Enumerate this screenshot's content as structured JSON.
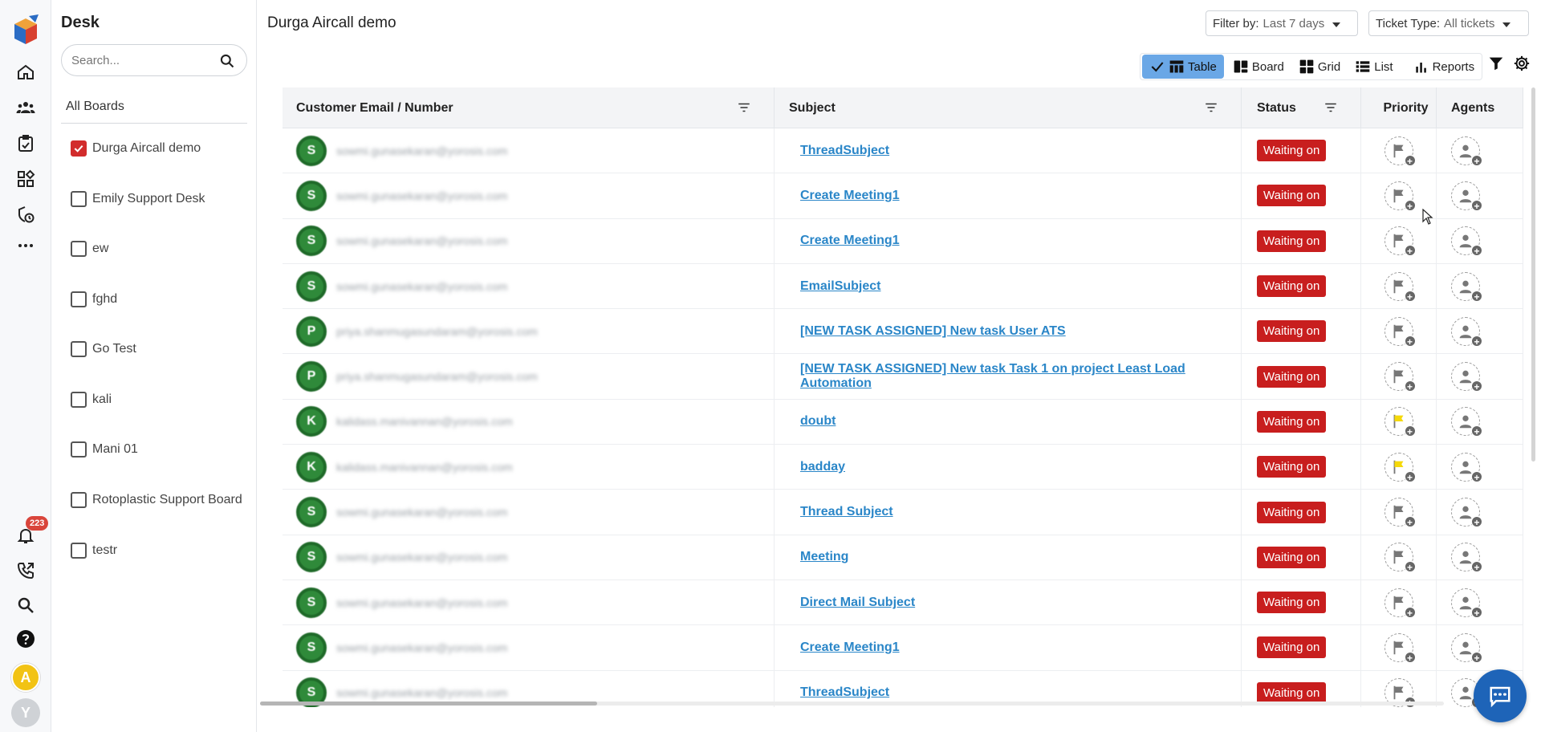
{
  "sidebar": {
    "title": "Desk",
    "search_placeholder": "Search...",
    "section_label": "All Boards",
    "notification_count": "223",
    "avatar_letters": [
      "A",
      "Y"
    ],
    "boards": [
      {
        "label": "Durga Aircall demo",
        "checked": true
      },
      {
        "label": "Emily Support Desk",
        "checked": false
      },
      {
        "label": "ew",
        "checked": false
      },
      {
        "label": "fghd",
        "checked": false
      },
      {
        "label": "Go Test",
        "checked": false
      },
      {
        "label": "kali",
        "checked": false
      },
      {
        "label": "Mani 01",
        "checked": false
      },
      {
        "label": "Rotoplastic Support Board",
        "checked": false
      },
      {
        "label": "testr",
        "checked": false
      }
    ]
  },
  "header": {
    "title": "Durga Aircall demo",
    "filter_label": "Filter by:",
    "filter_value": "Last 7 days",
    "ticket_type_label": "Ticket Type:",
    "ticket_type_value": "All tickets"
  },
  "views": {
    "table": "Table",
    "board": "Board",
    "grid": "Grid",
    "list": "List",
    "reports": "Reports",
    "active": "Table"
  },
  "table": {
    "columns": [
      "Customer Email / Number",
      "Subject",
      "Status",
      "Priority",
      "Agents"
    ],
    "rows": [
      {
        "initial": "S",
        "email": "sowmi.gunasekaran@yorosis.com",
        "subject": "ThreadSubject",
        "status": "Waiting on",
        "priority": "none"
      },
      {
        "initial": "S",
        "email": "sowmi.gunasekaran@yorosis.com",
        "subject": "Create Meeting1",
        "status": "Waiting on",
        "priority": "none"
      },
      {
        "initial": "S",
        "email": "sowmi.gunasekaran@yorosis.com",
        "subject": "Create Meeting1",
        "status": "Waiting on",
        "priority": "none"
      },
      {
        "initial": "S",
        "email": "sowmi.gunasekaran@yorosis.com",
        "subject": "EmailSubject",
        "status": "Waiting on",
        "priority": "none"
      },
      {
        "initial": "P",
        "email": "priya.shanmugasundaram@yorosis.com",
        "subject": "[NEW TASK ASSIGNED] New task User ATS",
        "status": "Waiting on",
        "priority": "none"
      },
      {
        "initial": "P",
        "email": "priya.shanmugasundaram@yorosis.com",
        "subject": "[NEW TASK ASSIGNED] New task Task 1 on project Least Load Automation",
        "status": "Waiting on",
        "priority": "none"
      },
      {
        "initial": "K",
        "email": "kalidass.manivannan@yorosis.com",
        "subject": "doubt",
        "status": "Waiting on",
        "priority": "medium"
      },
      {
        "initial": "K",
        "email": "kalidass.manivannan@yorosis.com",
        "subject": "badday",
        "status": "Waiting on",
        "priority": "medium"
      },
      {
        "initial": "S",
        "email": "sowmi.gunasekaran@yorosis.com",
        "subject": "Thread Subject",
        "status": "Waiting on",
        "priority": "none"
      },
      {
        "initial": "S",
        "email": "sowmi.gunasekaran@yorosis.com",
        "subject": "Meeting",
        "status": "Waiting on",
        "priority": "none"
      },
      {
        "initial": "S",
        "email": "sowmi.gunasekaran@yorosis.com",
        "subject": "Direct Mail Subject",
        "status": "Waiting on",
        "priority": "none"
      },
      {
        "initial": "S",
        "email": "sowmi.gunasekaran@yorosis.com",
        "subject": "Create Meeting1",
        "status": "Waiting on",
        "priority": "none"
      },
      {
        "initial": "S",
        "email": "sowmi.gunasekaran@yorosis.com",
        "subject": "ThreadSubject",
        "status": "Waiting on",
        "priority": "none"
      }
    ]
  },
  "colors": {
    "status_bg": "#c81e1e",
    "link": "#2a86c8",
    "active_view": "#6aa7e6",
    "avatar_green": "#2f8a3a",
    "priority_medium": "#f5d90a",
    "chat_fab": "#1e64b8"
  },
  "icons": [
    "logo-icon",
    "home-icon",
    "team-icon",
    "tasks-icon",
    "apps-icon",
    "shield-icon",
    "more-icon",
    "bell-icon",
    "phone-icon",
    "search-icon",
    "help-icon",
    "filter-icon",
    "settings-icon",
    "flag-icon",
    "add-agent-icon",
    "chat-icon"
  ]
}
